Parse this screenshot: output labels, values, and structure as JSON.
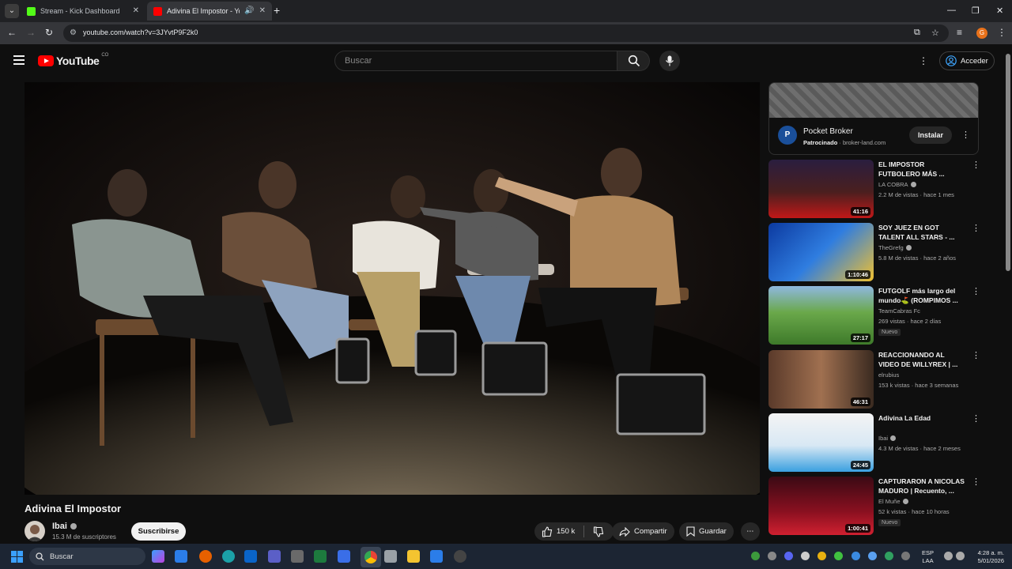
{
  "browser": {
    "tabs": [
      {
        "title": "Stream - Kick Dashboard",
        "favicon_color": "#53fc18",
        "active": false
      },
      {
        "title": "Adivina El Impostor - YouTube",
        "favicon_color": "#ff0000",
        "active": true
      }
    ],
    "url": "youtube.com/watch?v=3JYvtP9F2k0",
    "profile_initial": "G"
  },
  "youtube": {
    "logo_text": "YouTube",
    "country_code": "CO",
    "search_placeholder": "Buscar",
    "signin_label": "Acceder"
  },
  "video": {
    "title": "Adivina El Impostor",
    "channel": "Ibai",
    "subscribers": "15.3 M de suscriptores",
    "subscribe_label": "Suscribirse",
    "likes": "150 k",
    "share_label": "Compartir",
    "save_label": "Guardar"
  },
  "ad": {
    "name": "Pocket Broker",
    "logo_letter": "P",
    "sponsored": "Patrocinado",
    "domain": "broker-land.com",
    "install_label": "Instalar"
  },
  "recommendations": [
    {
      "title": "EL IMPOSTOR FUTBOLERO MÁS ...",
      "channel": "LA COBRA",
      "verified": true,
      "views": "2.2 M de vistas",
      "age": "hace 1 mes",
      "duration": "41:16",
      "badge": ""
    },
    {
      "title": "SOY JUEZ EN GOT TALENT ALL STARS - ...",
      "channel": "TheGrefg",
      "verified": true,
      "views": "5.8 M de vistas",
      "age": "hace 2 años",
      "duration": "1:10:46",
      "badge": ""
    },
    {
      "title": "FUTGOLF más largo del mundo⛳ (ROMPIMOS ...",
      "channel": "TeamCabras Fc",
      "verified": false,
      "views": "269 vistas",
      "age": "hace 2 días",
      "duration": "27:17",
      "badge": "Nuevo"
    },
    {
      "title": "REACCIONANDO AL VIDEO DE WILLYREX | ...",
      "channel": "elrubius",
      "verified": false,
      "views": "153 k vistas",
      "age": "hace 3 semanas",
      "duration": "46:31",
      "badge": ""
    },
    {
      "title": "Adivina La Edad",
      "channel": "Ibai",
      "verified": true,
      "views": "4.3 M de vistas",
      "age": "hace 2 meses",
      "duration": "24:45",
      "badge": ""
    },
    {
      "title": "CAPTURARON A NICOLAS MADURO | Recuento, ...",
      "channel": "El Muñe",
      "verified": true,
      "views": "52 k vistas",
      "age": "hace 10 horas",
      "duration": "1:00:41",
      "badge": "Nuevo"
    }
  ],
  "taskbar": {
    "search_label": "Buscar",
    "language": "ESP",
    "layout": "LAA",
    "time": "4:28 a. m.",
    "date": "5/01/2026"
  }
}
